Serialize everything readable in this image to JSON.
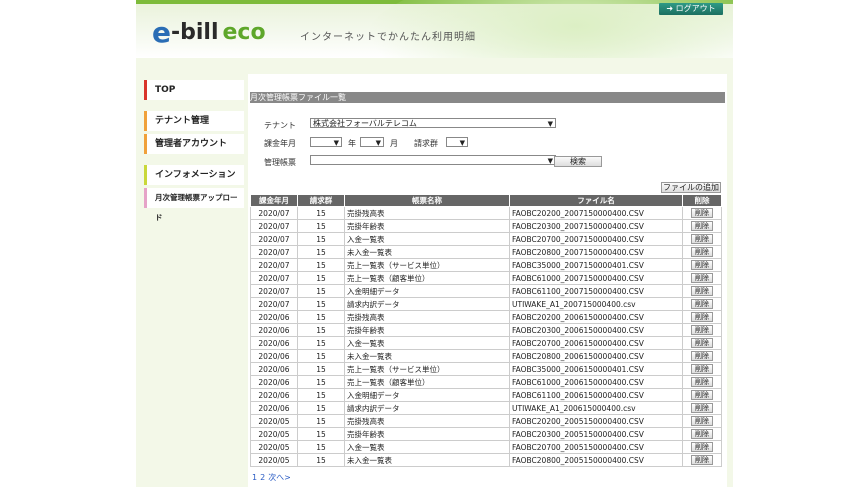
{
  "header": {
    "logo_e": "e",
    "logo_bill": "-bill",
    "logo_eco": "eco",
    "tagline": "インターネットでかんたん利用明細",
    "logout_label": "ログアウト",
    "logout_icon": "arrow-icon"
  },
  "sidebar": {
    "items": [
      {
        "label": "TOP",
        "color": "#d9342b"
      },
      {
        "label": "テナント管理",
        "color": "#f0a13a"
      },
      {
        "label": "管理者アカウント",
        "color": "#f0a13a"
      },
      {
        "label": "インフォメーション",
        "color": "#c9d83a"
      },
      {
        "label": "月次管理帳票アップロード",
        "color": "#e6a3c8"
      }
    ]
  },
  "main": {
    "section_title": "月次管理帳票ファイル一覧",
    "form": {
      "tenant_label": "テナント",
      "tenant_value": "株式会社フォーバルテレコム",
      "billing_ym_label": "課金年月",
      "year_unit": "年",
      "month_unit": "月",
      "group_label": "請求群",
      "report_label": "管理帳票",
      "search_label": "検索"
    },
    "add_file_label": "ファイルの追加",
    "table": {
      "headers": [
        "課金年月",
        "請求群",
        "帳票名称",
        "ファイル名",
        "削除"
      ],
      "delete_label": "削除",
      "rows": [
        [
          "2020/07",
          "15",
          "売掛残高表",
          "FAOBC20200_2007150000400.CSV"
        ],
        [
          "2020/07",
          "15",
          "売掛年齢表",
          "FAOBC20300_2007150000400.CSV"
        ],
        [
          "2020/07",
          "15",
          "入金一覧表",
          "FAOBC20700_2007150000400.CSV"
        ],
        [
          "2020/07",
          "15",
          "未入金一覧表",
          "FAOBC20800_2007150000400.CSV"
        ],
        [
          "2020/07",
          "15",
          "売上一覧表（サービス単位）",
          "FAOBC35000_2007150000401.CSV"
        ],
        [
          "2020/07",
          "15",
          "売上一覧表（顧客単位）",
          "FAOBC61000_2007150000400.CSV"
        ],
        [
          "2020/07",
          "15",
          "入金明細データ",
          "FAOBC61100_2007150000400.CSV"
        ],
        [
          "2020/07",
          "15",
          "請求内訳データ",
          "UTIWAKE_A1_200715000400.csv"
        ],
        [
          "2020/06",
          "15",
          "売掛残高表",
          "FAOBC20200_2006150000400.CSV"
        ],
        [
          "2020/06",
          "15",
          "売掛年齢表",
          "FAOBC20300_2006150000400.CSV"
        ],
        [
          "2020/06",
          "15",
          "入金一覧表",
          "FAOBC20700_2006150000400.CSV"
        ],
        [
          "2020/06",
          "15",
          "未入金一覧表",
          "FAOBC20800_2006150000400.CSV"
        ],
        [
          "2020/06",
          "15",
          "売上一覧表（サービス単位）",
          "FAOBC35000_2006150000401.CSV"
        ],
        [
          "2020/06",
          "15",
          "売上一覧表（顧客単位）",
          "FAOBC61000_2006150000400.CSV"
        ],
        [
          "2020/06",
          "15",
          "入金明細データ",
          "FAOBC61100_2006150000400.CSV"
        ],
        [
          "2020/06",
          "15",
          "請求内訳データ",
          "UTIWAKE_A1_200615000400.csv"
        ],
        [
          "2020/05",
          "15",
          "売掛残高表",
          "FAOBC20200_2005150000400.CSV"
        ],
        [
          "2020/05",
          "15",
          "売掛年齢表",
          "FAOBC20300_2005150000400.CSV"
        ],
        [
          "2020/05",
          "15",
          "入金一覧表",
          "FAOBC20700_2005150000400.CSV"
        ],
        [
          "2020/05",
          "15",
          "未入金一覧表",
          "FAOBC20800_2005150000400.CSV"
        ]
      ]
    },
    "pager": {
      "pages": [
        "1",
        "2"
      ],
      "next_label": "次へ>"
    }
  }
}
